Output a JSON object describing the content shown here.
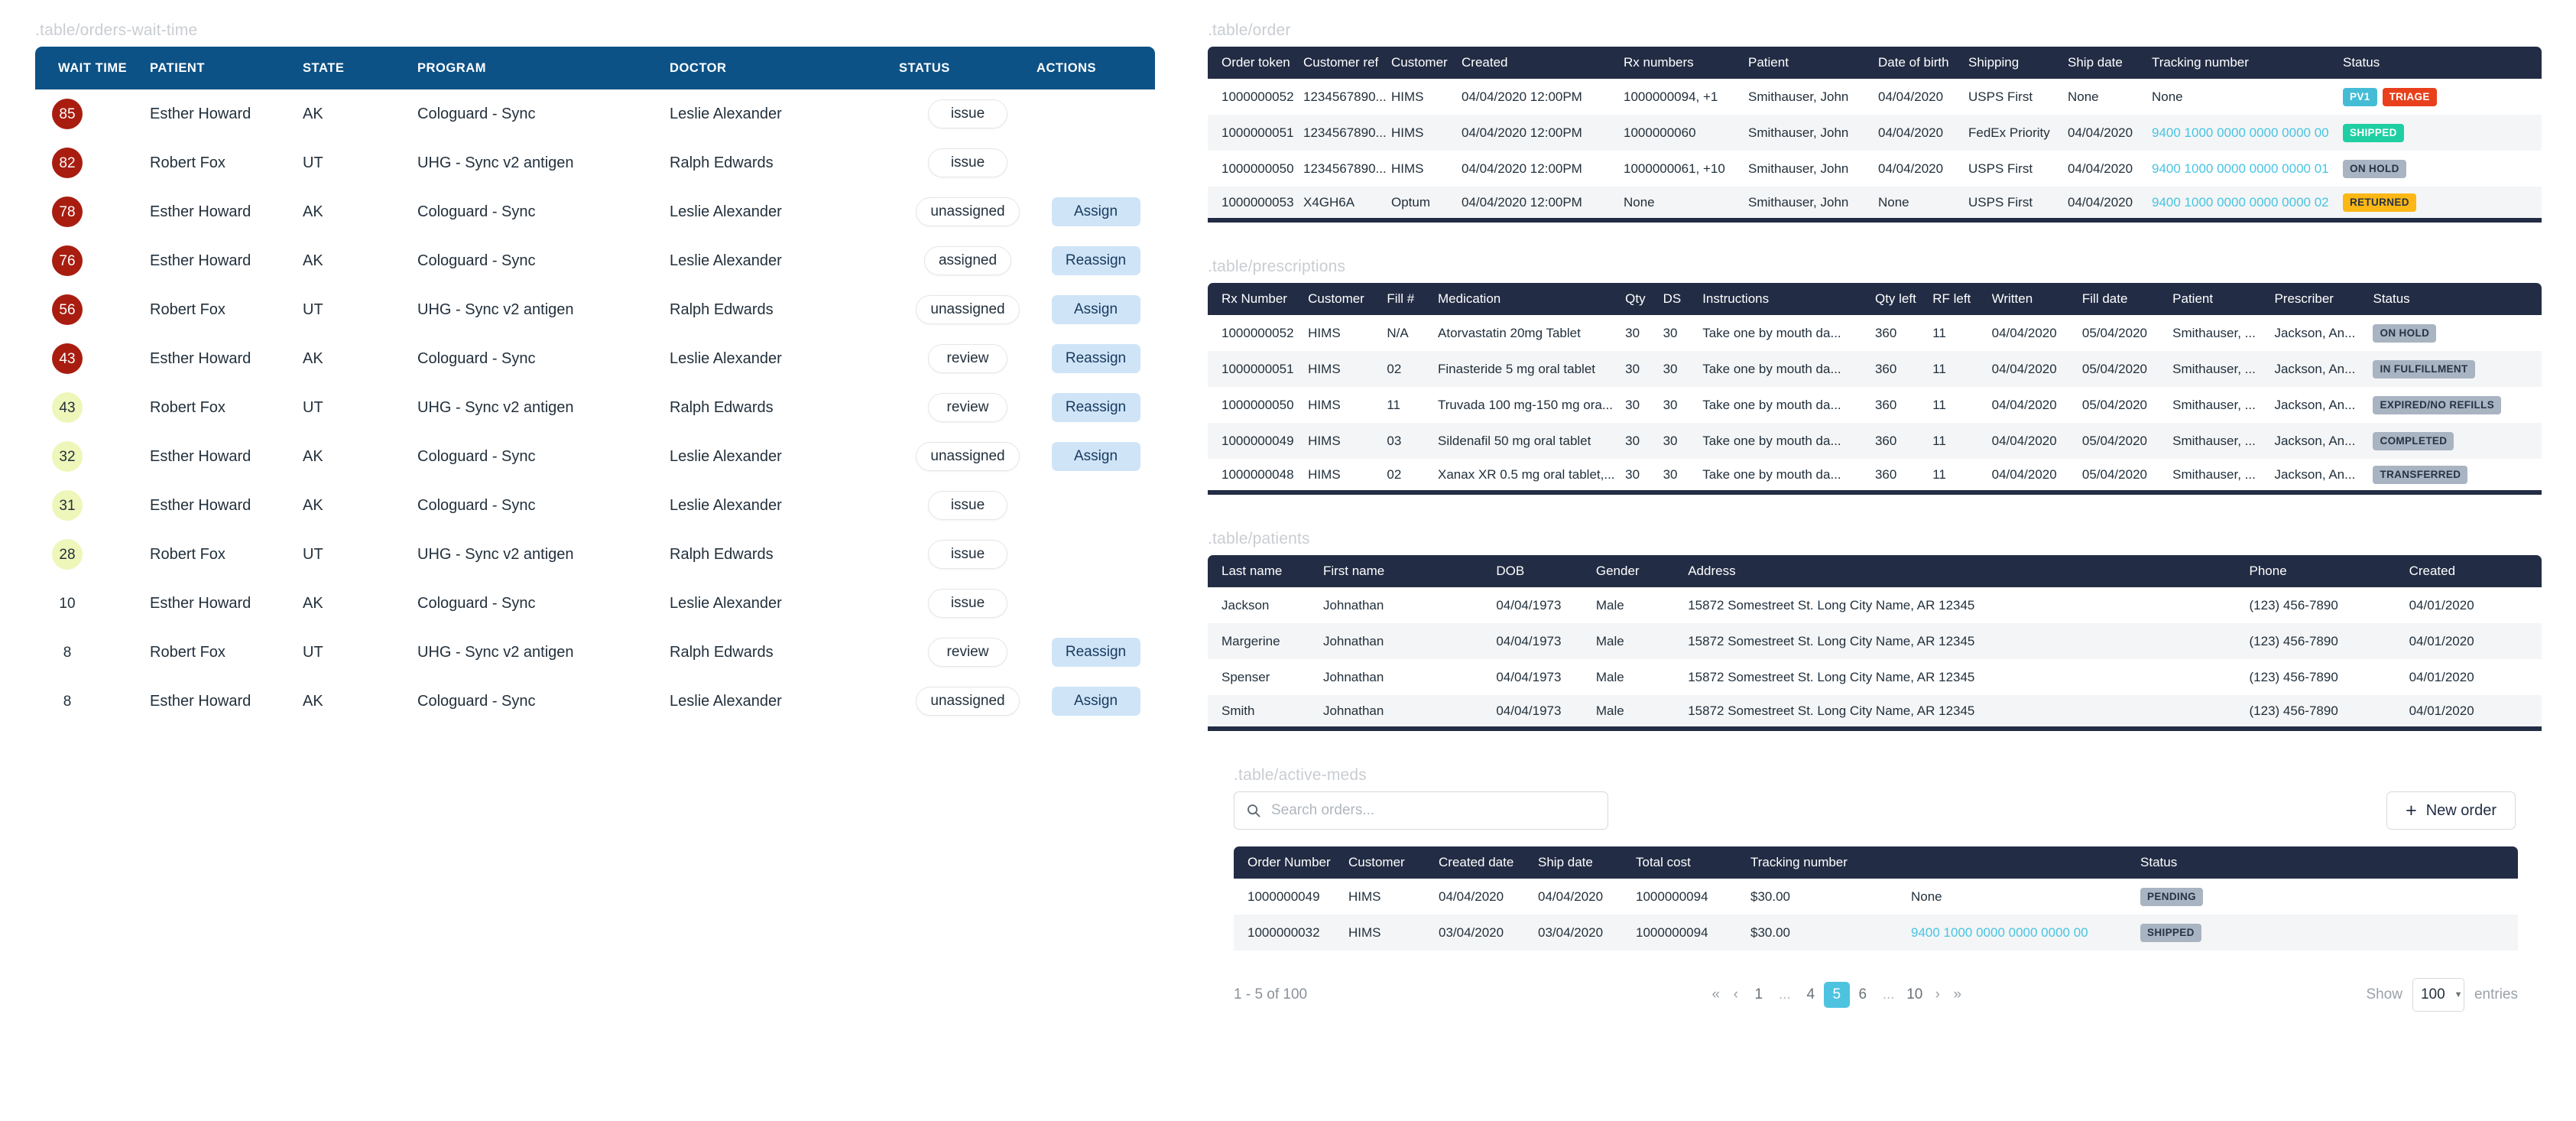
{
  "wait_table": {
    "caption": ".table/orders-wait-time",
    "columns": [
      "WAIT TIME",
      "PATIENT",
      "STATE",
      "PROGRAM",
      "DOCTOR",
      "STATUS",
      "ACTIONS"
    ],
    "rows": [
      {
        "wait": "85",
        "tone": "red",
        "patient": "Esther Howard",
        "state": "AK",
        "program": "Cologuard - Sync",
        "doctor": "Leslie Alexander",
        "status": "issue",
        "action": ""
      },
      {
        "wait": "82",
        "tone": "red",
        "patient": "Robert Fox",
        "state": "UT",
        "program": "UHG - Sync v2 antigen",
        "doctor": "Ralph Edwards",
        "status": "issue",
        "action": ""
      },
      {
        "wait": "78",
        "tone": "red",
        "patient": "Esther Howard",
        "state": "AK",
        "program": "Cologuard - Sync",
        "doctor": "Leslie Alexander",
        "status": "unassigned",
        "action": "Assign"
      },
      {
        "wait": "76",
        "tone": "red",
        "patient": "Esther Howard",
        "state": "AK",
        "program": "Cologuard - Sync",
        "doctor": "Leslie Alexander",
        "status": "assigned",
        "action": "Reassign"
      },
      {
        "wait": "56",
        "tone": "red",
        "patient": "Robert Fox",
        "state": "UT",
        "program": "UHG - Sync v2 antigen",
        "doctor": "Ralph Edwards",
        "status": "unassigned",
        "action": "Assign"
      },
      {
        "wait": "43",
        "tone": "red",
        "patient": "Esther Howard",
        "state": "AK",
        "program": "Cologuard - Sync",
        "doctor": "Leslie Alexander",
        "status": "review",
        "action": "Reassign"
      },
      {
        "wait": "43",
        "tone": "yellow",
        "patient": "Robert Fox",
        "state": "UT",
        "program": "UHG - Sync v2 antigen",
        "doctor": "Ralph Edwards",
        "status": "review",
        "action": "Reassign"
      },
      {
        "wait": "32",
        "tone": "yellow",
        "patient": "Esther Howard",
        "state": "AK",
        "program": "Cologuard - Sync",
        "doctor": "Leslie Alexander",
        "status": "unassigned",
        "action": "Assign"
      },
      {
        "wait": "31",
        "tone": "yellow",
        "patient": "Esther Howard",
        "state": "AK",
        "program": "Cologuard - Sync",
        "doctor": "Leslie Alexander",
        "status": "issue",
        "action": ""
      },
      {
        "wait": "28",
        "tone": "yellow",
        "patient": "Robert Fox",
        "state": "UT",
        "program": "UHG - Sync v2 antigen",
        "doctor": "Ralph Edwards",
        "status": "issue",
        "action": ""
      },
      {
        "wait": "10",
        "tone": "none",
        "patient": "Esther Howard",
        "state": "AK",
        "program": "Cologuard - Sync",
        "doctor": "Leslie Alexander",
        "status": "issue",
        "action": ""
      },
      {
        "wait": "8",
        "tone": "none",
        "patient": "Robert Fox",
        "state": "UT",
        "program": "UHG - Sync v2 antigen",
        "doctor": "Ralph Edwards",
        "status": "review",
        "action": "Reassign"
      },
      {
        "wait": "8",
        "tone": "none",
        "patient": "Esther Howard",
        "state": "AK",
        "program": "Cologuard - Sync",
        "doctor": "Leslie Alexander",
        "status": "unassigned",
        "action": "Assign"
      }
    ]
  },
  "order_table": {
    "caption": ".table/order",
    "columns": [
      "Order token",
      "Customer ref",
      "Customer",
      "Created",
      "Rx numbers",
      "Patient",
      "Date of birth",
      "Shipping",
      "Ship date",
      "Tracking number",
      "Status"
    ],
    "rows": [
      {
        "token": "1000000052",
        "cref": "1234567890...",
        "customer": "HIMS",
        "created": "04/04/2020 12:00PM",
        "rx": "1000000094, +1",
        "patient": "Smithauser, John",
        "dob": "04/04/2020",
        "shipping": "USPS First",
        "ship": "None",
        "tracking": "None",
        "tracking_link": false,
        "badges": [
          {
            "label": "PV1",
            "color": "#45bcd5"
          },
          {
            "label": "TRIAGE",
            "color": "#e8401c"
          }
        ]
      },
      {
        "token": "1000000051",
        "cref": "1234567890...",
        "customer": "HIMS",
        "created": "04/04/2020 12:00PM",
        "rx": "1000000060",
        "patient": "Smithauser, John",
        "dob": "04/04/2020",
        "shipping": "FedEx Priority",
        "ship": "04/04/2020",
        "tracking": "9400 1000 0000 0000 0000 00",
        "tracking_link": true,
        "badges": [
          {
            "label": "SHIPPED",
            "color": "#1fcfa3"
          }
        ]
      },
      {
        "token": "1000000050",
        "cref": "1234567890...",
        "customer": "HIMS",
        "created": "04/04/2020 12:00PM",
        "rx": "1000000061, +10",
        "patient": "Smithauser, John",
        "dob": "04/04/2020",
        "shipping": "USPS First",
        "ship": "04/04/2020",
        "tracking": "9400 1000 0000 0000 0000 01",
        "tracking_link": true,
        "badges": [
          {
            "label": "ON HOLD",
            "color": "#a9b4c2",
            "dark": true
          }
        ]
      },
      {
        "token": "1000000053",
        "cref": "X4GH6A",
        "customer": "Optum",
        "created": "04/04/2020 12:00PM",
        "rx": "None",
        "patient": "Smithauser, John",
        "dob": "None",
        "shipping": "USPS First",
        "ship": "04/04/2020",
        "tracking": "9400 1000 0000 0000 0000 02",
        "tracking_link": true,
        "badges": [
          {
            "label": "RETURNED",
            "color": "#fbb713",
            "dark": true
          }
        ]
      }
    ]
  },
  "prescriptions_table": {
    "caption": ".table/prescriptions",
    "columns": [
      "Rx Number",
      "Customer",
      "Fill #",
      "Medication",
      "Qty",
      "DS",
      "Instructions",
      "Qty left",
      "RF left",
      "Written",
      "Fill date",
      "Patient",
      "Prescriber",
      "Status"
    ],
    "rows": [
      {
        "rx": "1000000052",
        "customer": "HIMS",
        "fill": "N/A",
        "med": "Atorvastatin 20mg Tablet",
        "qty": "30",
        "ds": "30",
        "instr": "Take one by mouth da...",
        "qtyleft": "360",
        "rfleft": "11",
        "written": "04/04/2020",
        "filldate": "05/04/2020",
        "patient": "Smithauser, ...",
        "prescriber": "Jackson, An...",
        "status": "ON HOLD"
      },
      {
        "rx": "1000000051",
        "customer": "HIMS",
        "fill": "02",
        "med": "Finasteride 5 mg oral tablet",
        "qty": "30",
        "ds": "30",
        "instr": "Take one by mouth da...",
        "qtyleft": "360",
        "rfleft": "11",
        "written": "04/04/2020",
        "filldate": "05/04/2020",
        "patient": "Smithauser, ...",
        "prescriber": "Jackson, An...",
        "status": "IN FULFILLMENT"
      },
      {
        "rx": "1000000050",
        "customer": "HIMS",
        "fill": "11",
        "med": "Truvada 100 mg-150 mg ora...",
        "qty": "30",
        "ds": "30",
        "instr": "Take one by mouth da...",
        "qtyleft": "360",
        "rfleft": "11",
        "written": "04/04/2020",
        "filldate": "05/04/2020",
        "patient": "Smithauser, ...",
        "prescriber": "Jackson, An...",
        "status": "EXPIRED/NO REFILLS"
      },
      {
        "rx": "1000000049",
        "customer": "HIMS",
        "fill": "03",
        "med": "Sildenafil 50 mg oral tablet",
        "qty": "30",
        "ds": "30",
        "instr": "Take one by mouth da...",
        "qtyleft": "360",
        "rfleft": "11",
        "written": "04/04/2020",
        "filldate": "05/04/2020",
        "patient": "Smithauser, ...",
        "prescriber": "Jackson, An...",
        "status": "COMPLETED"
      },
      {
        "rx": "1000000048",
        "customer": "HIMS",
        "fill": "02",
        "med": "Xanax XR 0.5 mg oral tablet,...",
        "qty": "30",
        "ds": "30",
        "instr": "Take one by mouth da...",
        "qtyleft": "360",
        "rfleft": "11",
        "written": "04/04/2020",
        "filldate": "05/04/2020",
        "patient": "Smithauser, ...",
        "prescriber": "Jackson, An...",
        "status": "TRANSFERRED"
      }
    ]
  },
  "patients_table": {
    "caption": ".table/patients",
    "columns": [
      "Last name",
      "First name",
      "DOB",
      "Gender",
      "Address",
      "Phone",
      "Created"
    ],
    "rows": [
      {
        "last": "Jackson",
        "first": "Johnathan",
        "dob": "04/04/1973",
        "gender": "Male",
        "address": "15872 Somestreet St. Long City Name, AR 12345",
        "phone": "(123) 456-7890",
        "created": "04/01/2020"
      },
      {
        "last": "Margerine",
        "first": "Johnathan",
        "dob": "04/04/1973",
        "gender": "Male",
        "address": "15872 Somestreet St. Long City Name, AR 12345",
        "phone": "(123) 456-7890",
        "created": "04/01/2020"
      },
      {
        "last": "Spenser",
        "first": "Johnathan",
        "dob": "04/04/1973",
        "gender": "Male",
        "address": "15872 Somestreet St. Long City Name, AR 12345",
        "phone": "(123) 456-7890",
        "created": "04/01/2020"
      },
      {
        "last": "Smith",
        "first": "Johnathan",
        "dob": "04/04/1973",
        "gender": "Male",
        "address": "15872 Somestreet St. Long City Name, AR 12345",
        "phone": "(123) 456-7890",
        "created": "04/01/2020"
      }
    ]
  },
  "active_meds": {
    "caption": ".table/active-meds",
    "search_placeholder": "Search orders...",
    "search_value": "",
    "new_order_label": "New order",
    "plus_glyph": "+",
    "columns": [
      "Order Number",
      "Customer",
      "Created date",
      "Ship date",
      "Total cost",
      "Tracking number",
      "Status"
    ],
    "rows": [
      {
        "num": "1000000049",
        "customer": "HIMS",
        "created": "04/04/2020",
        "ship": "04/04/2020",
        "order_ref": "1000000094",
        "cost": "$30.00",
        "tracking": "None",
        "tracking_link": false,
        "status": "PENDING"
      },
      {
        "num": "1000000032",
        "customer": "HIMS",
        "created": "03/04/2020",
        "ship": "03/04/2020",
        "order_ref": "1000000094",
        "cost": "$30.00",
        "tracking": "9400 1000 0000 0000 0000 00",
        "tracking_link": true,
        "status": "SHIPPED"
      }
    ]
  },
  "pagination": {
    "range_label": "1 - 5 of 100",
    "first_glyph": "«",
    "prev_glyph": "‹",
    "next_glyph": "›",
    "last_glyph": "»",
    "pages": [
      "1",
      "...",
      "4",
      "5",
      "6",
      "...",
      "10"
    ],
    "active_page": "5",
    "show_label": "Show",
    "page_size": "100",
    "entries_label": "entries",
    "caret_glyph": "▼"
  }
}
